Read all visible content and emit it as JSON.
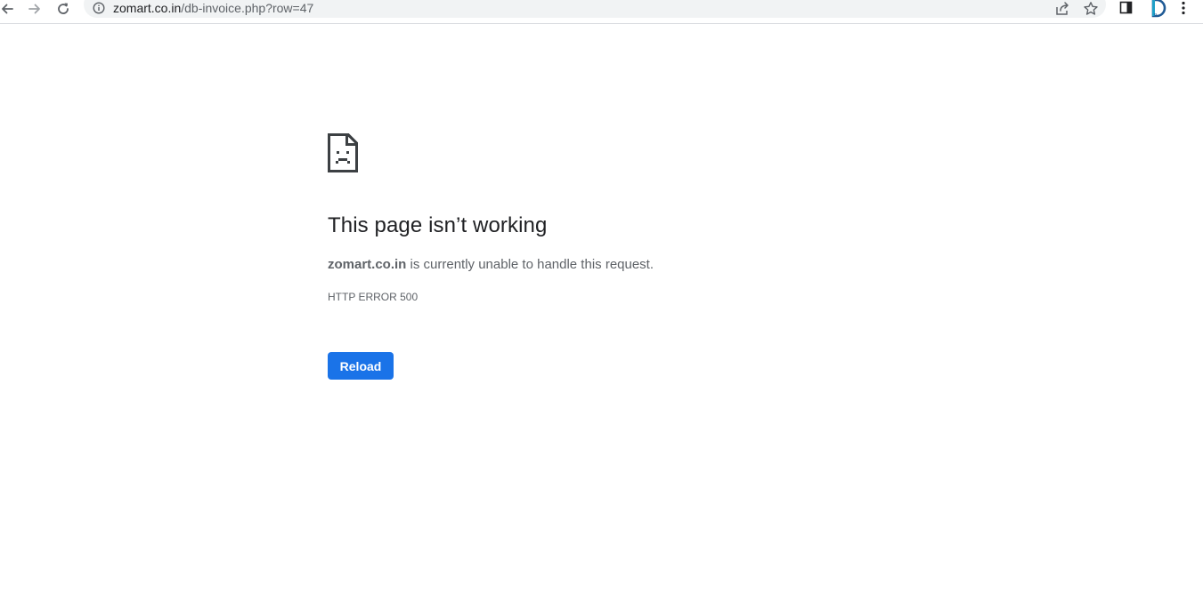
{
  "browser": {
    "address_bar": {
      "host": "zomart.co.in",
      "path": "/db-invoice.php?row=47"
    },
    "icons": {
      "back": "arrow-left-icon",
      "forward": "arrow-right-icon",
      "reload": "refresh-icon",
      "site_info": "info-icon",
      "share": "share-icon",
      "bookmark": "star-icon",
      "side_panel": "side-panel-icon",
      "profile": "profile-avatar-icon",
      "menu": "kebab-menu-icon"
    }
  },
  "error_page": {
    "icon": "sad-page-icon",
    "title": "This page isn’t working",
    "host": "zomart.co.in",
    "message": " is currently unable to handle this request.",
    "error_code": "HTTP ERROR 500",
    "reload_label": "Reload",
    "accent_color": "#1a73e8"
  }
}
